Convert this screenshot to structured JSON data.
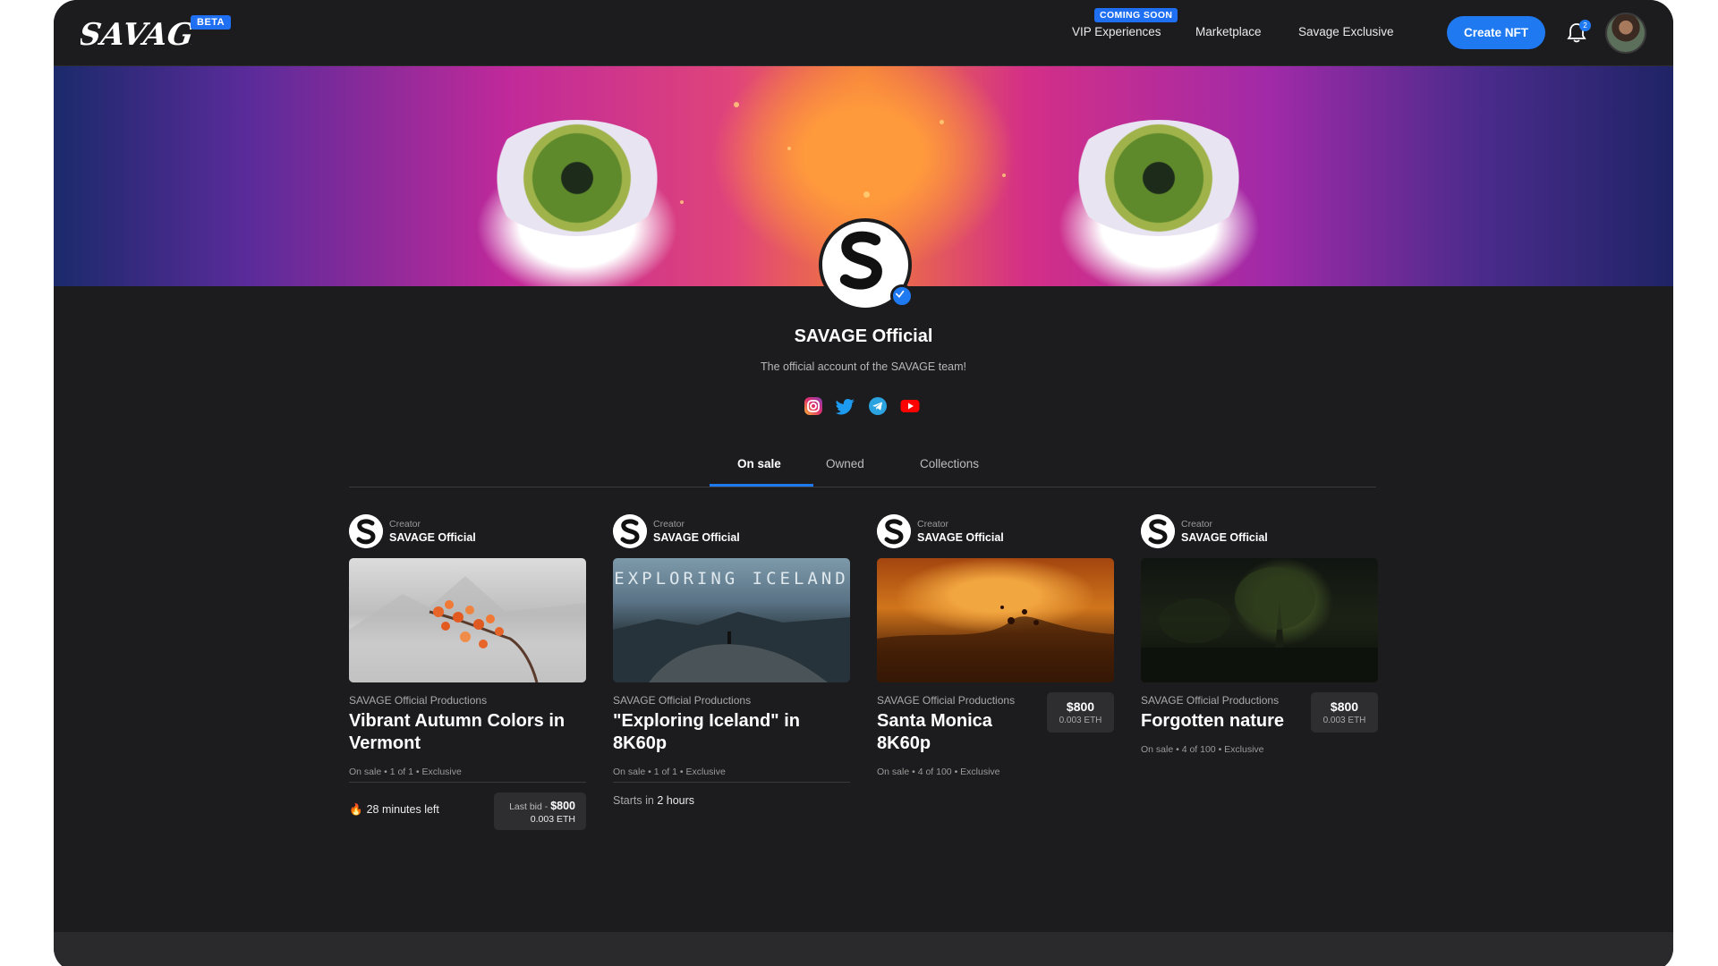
{
  "header": {
    "logo_text": "SAVAGE",
    "beta_badge": "BETA",
    "coming_soon_badge": "COMING SOON",
    "nav": [
      "VIP Experiences",
      "Marketplace",
      "Savage Exclusive"
    ],
    "create_button": "Create NFT",
    "notification_count": "2"
  },
  "profile": {
    "name": "SAVAGE Official",
    "bio": "The official account of the SAVAGE team!",
    "verified": true,
    "socials": [
      "instagram-icon",
      "twitter-icon",
      "telegram-icon",
      "youtube-icon"
    ]
  },
  "tabs": [
    {
      "label": "On sale",
      "active": true
    },
    {
      "label": "Owned",
      "active": false
    },
    {
      "label": "Collections",
      "active": false
    }
  ],
  "cards": [
    {
      "creator_label": "Creator",
      "creator_name": "SAVAGE Official",
      "producer": "SAVAGE Official Productions",
      "title": "Vibrant Autumn Colors in Vermont",
      "meta": "On sale • 1 of 1 • Exclusive",
      "timer": "28 minutes left",
      "bid_label": "Last bid - ",
      "bid_usd": "$800",
      "bid_eth": "0.003 ETH"
    },
    {
      "creator_label": "Creator",
      "creator_name": "SAVAGE Official",
      "thumb_text": "EXPLORING ICELAND",
      "producer": "SAVAGE Official Productions",
      "title": "\"Exploring Iceland\" in 8K60p",
      "meta": "On sale • 1 of 1 • Exclusive",
      "starts_label": "Starts in ",
      "starts_value": "2 hours"
    },
    {
      "creator_label": "Creator",
      "creator_name": "SAVAGE Official",
      "producer": "SAVAGE Official Productions",
      "title": "Santa Monica 8K60p",
      "meta": "On sale • 4 of 100 • Exclusive",
      "price_usd": "$800",
      "price_eth": "0.003 ETH"
    },
    {
      "creator_label": "Creator",
      "creator_name": "SAVAGE Official",
      "producer": "SAVAGE Official Productions",
      "title": "Forgotten nature",
      "meta": "On sale • 4 of 100 • Exclusive",
      "price_usd": "$800",
      "price_eth": "0.003 ETH"
    }
  ],
  "colors": {
    "background": "#1c1c1e",
    "accent": "#1f7af2",
    "panel": "#2e2e31"
  }
}
